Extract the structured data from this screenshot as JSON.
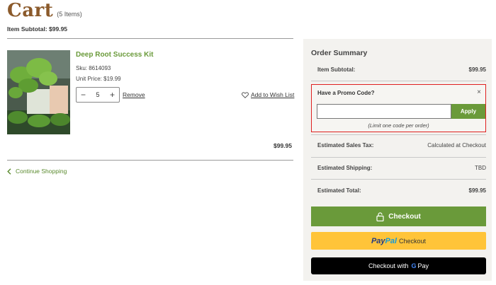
{
  "cart": {
    "title": "Cart",
    "item_count": "(5 Items)",
    "item_subtotal": "Item Subtotal: $99.95"
  },
  "item": {
    "name": "Deep Root Success Kit",
    "sku": "Sku: 8614093",
    "unit_price": "Unit Price: $19.99",
    "quantity": "5",
    "remove_label": "Remove",
    "wishlist_label": "Add to Wish List",
    "line_total": "$99.95"
  },
  "continue_label": "Continue Shopping",
  "summary": {
    "title": "Order Summary",
    "item_subtotal_label": "Item Subtotal:",
    "item_subtotal_value": "$99.95",
    "promo": {
      "title": "Have a Promo Code?",
      "close": "×",
      "input_value": "",
      "apply_label": "Apply",
      "limit_note": "(Limit one code per order)"
    },
    "tax_label": "Estimated Sales Tax:",
    "tax_value": "Calculated at Checkout",
    "shipping_label": "Estimated Shipping:",
    "shipping_value": "TBD",
    "total_label": "Estimated Total:",
    "total_value": "$99.95"
  },
  "buttons": {
    "checkout_label": "Checkout",
    "paypal_pay": "Pay",
    "paypal_pal": "Pal",
    "paypal_checkout": "Checkout",
    "gpay_prefix": "Checkout with",
    "gpay_g": "G",
    "gpay_pay": "Pay"
  },
  "colors": {
    "brand_green": "#6a9a3a",
    "title_brown": "#8b5a2b",
    "paypal_yellow": "#ffc439",
    "promo_highlight": "#e02020"
  },
  "icons": {
    "remove_qty": "minus-icon",
    "add_qty": "plus-icon",
    "wishlist": "heart-icon",
    "continue": "chevron-left-icon",
    "checkout": "lock-icon",
    "promo_close": "close-icon"
  }
}
